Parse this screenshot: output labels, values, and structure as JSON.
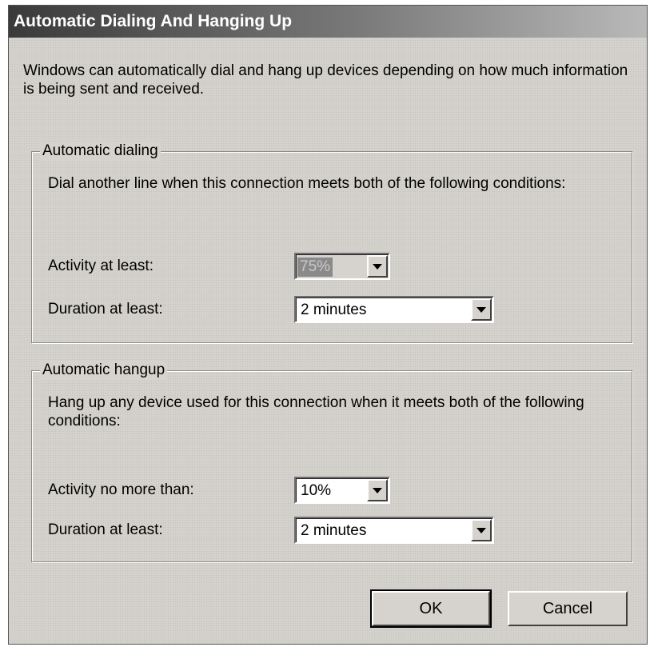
{
  "dialog": {
    "title": "Automatic Dialing And Hanging Up",
    "intro": "Windows can automatically dial and hang up devices depending on how much information is being sent and received."
  },
  "auto_dial": {
    "legend": "Automatic dialing",
    "description": "Dial another line when this connection meets both of the following conditions:",
    "activity_label": "Activity at least:",
    "activity_value": "75%",
    "duration_label": "Duration at least:",
    "duration_value": "2 minutes"
  },
  "auto_hangup": {
    "legend": "Automatic hangup",
    "description": "Hang up any device used for this connection when it meets both of the following conditions:",
    "activity_label": "Activity no more than:",
    "activity_value": "10%",
    "duration_label": "Duration at least:",
    "duration_value": "2 minutes"
  },
  "buttons": {
    "ok": "OK",
    "cancel": "Cancel"
  }
}
